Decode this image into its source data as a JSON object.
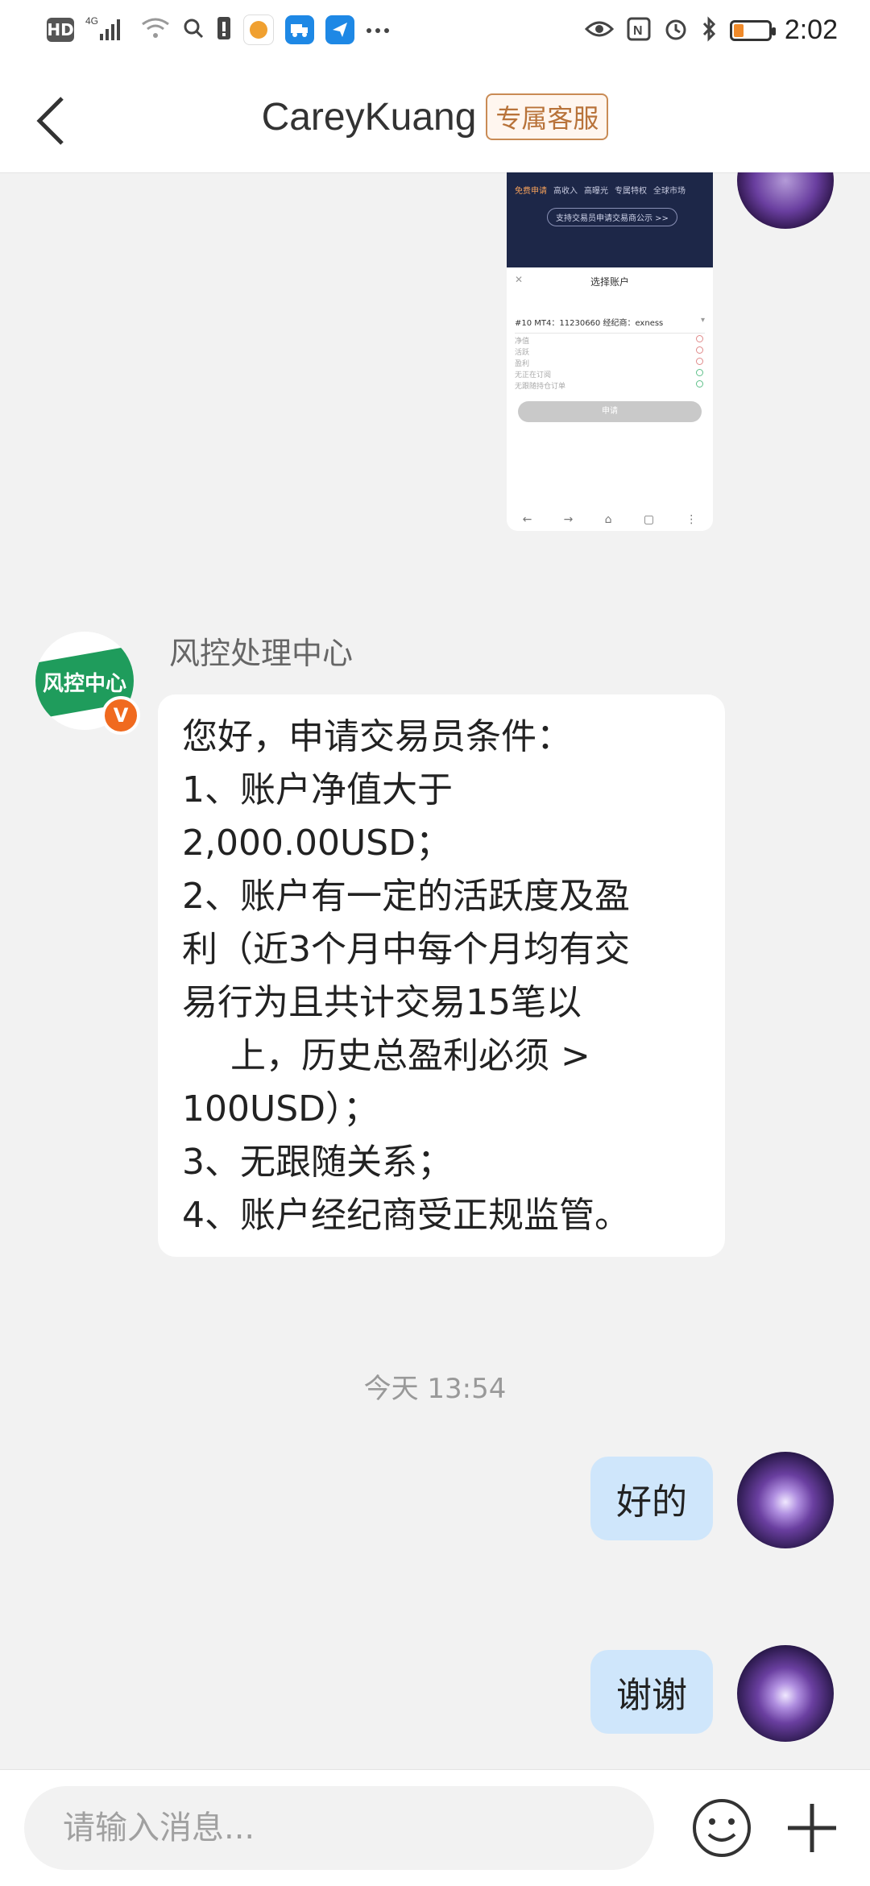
{
  "status_bar": {
    "left_badge": "HD",
    "network": "4G",
    "time": "2:02",
    "battery_color": "#f08a2a"
  },
  "header": {
    "title": "CareyKuang",
    "tag": "专属客服"
  },
  "shared_image": {
    "tabs": [
      "免费申请",
      "高收入",
      "高曝光",
      "专属特权",
      "全球市场"
    ],
    "promo_button": "支持交易员申请交易商公示 >>",
    "sheet_title": "选择账户",
    "account": "#10 MT4：11230660 经纪商：exness",
    "rows": [
      "净值",
      "活跃",
      "盈利",
      "无正在订阅",
      "无跟随持仓订单"
    ],
    "apply_button": "申请"
  },
  "incoming": {
    "sender": "风控处理中心",
    "avatar_text": "风控中心",
    "verified_badge": "V",
    "lines": [
      "您好，申请交易员条件：",
      "1、账户净值大于",
      "2,000.00USD；",
      "2、账户有一定的活跃度及盈",
      "利（近3个月中每个月均有交",
      "易行为且共计交易15笔以",
      "上，历史总盈利必须 >",
      "100USD）；",
      "3、无跟随关系；",
      "4、账户经纪商受正规监管。"
    ]
  },
  "timestamp": "今天 13:54",
  "outgoing": [
    {
      "text": "好的"
    },
    {
      "text": "谢谢"
    }
  ],
  "input_bar": {
    "placeholder": "请输入消息..."
  },
  "colors": {
    "outgoing_bubble": "#cfe6fb",
    "tag": "#b8733a",
    "verified": "#f06a1f",
    "avatar_green": "#1f9c5c"
  }
}
